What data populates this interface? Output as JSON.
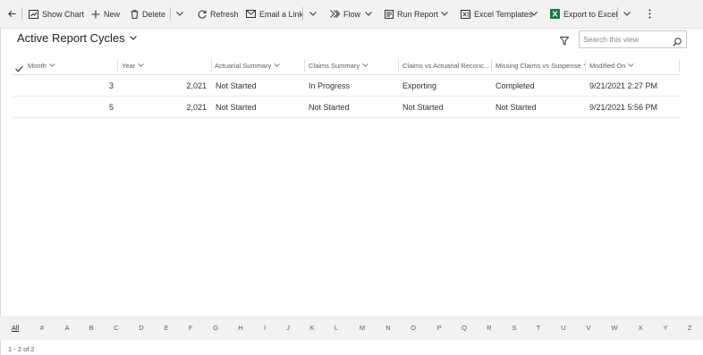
{
  "toolbar": {
    "show_chart": "Show Chart",
    "new": "New",
    "delete": "Delete",
    "refresh": "Refresh",
    "email_link": "Email a Link",
    "flow": "Flow",
    "run_report": "Run Report",
    "excel_templates": "Excel Templates",
    "export_excel": "Export to Excel"
  },
  "view": {
    "title": "Active Report Cycles",
    "search_placeholder": "Search this view"
  },
  "columns": [
    "Month",
    "Year",
    "Actuarial Summary",
    "Claims Summary",
    "Claims vs Actuarial Reconc...",
    "Missing Claims vs Suspense",
    "Modified On"
  ],
  "rows": [
    [
      "3",
      "2,021",
      "Not Started",
      "In Progress",
      "Exporting",
      "Completed",
      "9/21/2021 2:27 PM"
    ],
    [
      "5",
      "2,021",
      "Not Started",
      "Not Started",
      "Not Started",
      "Not Started",
      "9/21/2021 5:56 PM"
    ]
  ],
  "jumpbar": [
    "All",
    "#",
    "A",
    "B",
    "C",
    "D",
    "E",
    "F",
    "G",
    "H",
    "I",
    "J",
    "K",
    "L",
    "M",
    "N",
    "O",
    "P",
    "Q",
    "R",
    "S",
    "T",
    "U",
    "V",
    "W",
    "X",
    "Y",
    "Z"
  ],
  "footer": {
    "record_count": "1 - 2 of 2"
  },
  "colors": {
    "accent": "#0078d4",
    "excel_green": "#107c41",
    "bar_bg": "#f3f2f1"
  }
}
